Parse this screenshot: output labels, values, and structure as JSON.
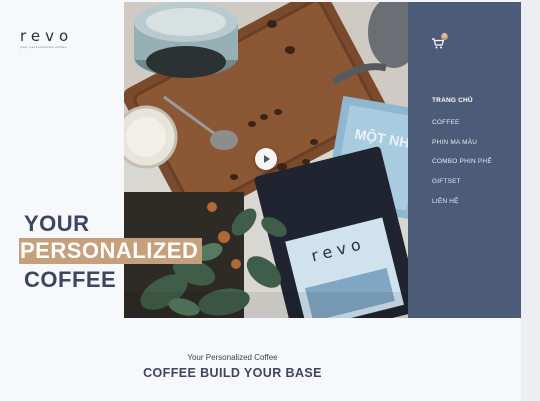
{
  "brand": {
    "logo_text": "revo",
    "tagline": "your personalized coffee"
  },
  "hero": {
    "line1": "YOUR",
    "line2": "PERSONALIZED",
    "line3": "COFFEE",
    "bag_brand": "revo",
    "book_text": "MỘT NHÌN",
    "play_label": "play video"
  },
  "nav": {
    "cart_count": "0",
    "items": [
      {
        "label": "TRANG CHỦ",
        "active": true
      },
      {
        "label": "COFFEE"
      },
      {
        "label": "PHIN MA MÀU"
      },
      {
        "label": "COMBO PHIN PHỂ"
      },
      {
        "label": "GIFTSET"
      },
      {
        "label": "LIÊN HỆ"
      }
    ]
  },
  "section": {
    "caption": "Your Personalized Coffee",
    "title": "COFFEE BUILD YOUR BASE"
  },
  "colors": {
    "navy": "#4b5b78",
    "heading": "#3b4660",
    "accent": "#c6a07c"
  }
}
